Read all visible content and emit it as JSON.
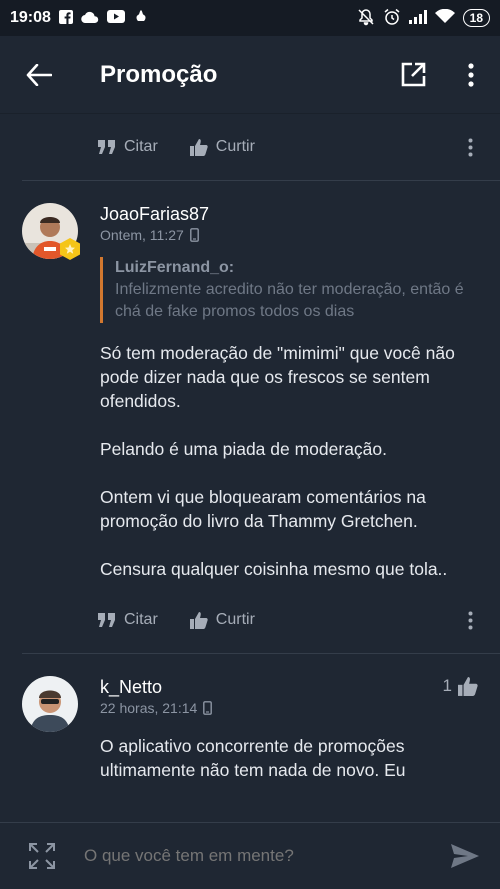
{
  "status_bar": {
    "time": "19:08",
    "battery": "18"
  },
  "app_bar": {
    "title": "Promoção"
  },
  "actions": {
    "cite": "Citar",
    "like": "Curtir"
  },
  "comments": [
    {
      "author": "JoaoFarias87",
      "time": "Ontem, 11:27",
      "quote": {
        "author": "LuizFernand_o:",
        "text": "Infelizmente acredito não ter moderação, então é chá de fake promos todos os dias"
      },
      "paragraphs": [
        "Só tem moderação de \"mimimi\" que você não pode dizer nada que os frescos se sentem ofendidos.",
        "Pelando é uma piada de moderação.",
        "Ontem vi que bloquearam comentários na promoção do livro da Thammy Gretchen.",
        "Censura qualquer coisinha mesmo que tola.."
      ]
    },
    {
      "author": "k_Netto",
      "time": "22 horas, 21:14",
      "likes": "1",
      "paragraphs": [
        "O aplicativo concorrente de promoções ultimamente não tem nada de novo. Eu"
      ]
    }
  ],
  "composer": {
    "placeholder": "O que você tem em mente?"
  },
  "colors": {
    "background": "#1f2733",
    "accent": "#d2782f",
    "badge": "#f5c518"
  }
}
